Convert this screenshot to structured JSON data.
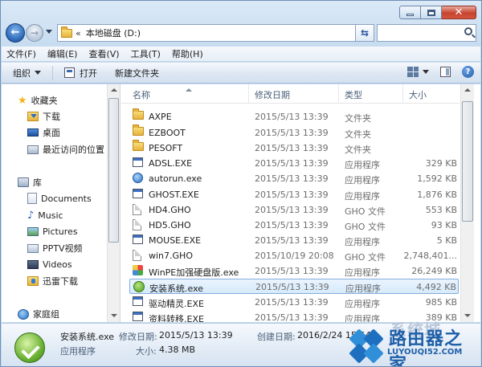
{
  "address": {
    "chevron": "«",
    "path": "本地磁盘 (D:)"
  },
  "menu": [
    "文件(F)",
    "编辑(E)",
    "查看(V)",
    "工具(T)",
    "帮助(H)"
  ],
  "toolbar": {
    "organize": "组织",
    "open": "打开",
    "new_folder": "新建文件夹"
  },
  "columns": {
    "name": "名称",
    "date": "修改日期",
    "type": "类型",
    "size": "大小"
  },
  "sidebar": [
    {
      "label": "收藏夹",
      "icon": "star-icon"
    },
    {
      "label": "下载",
      "icon": "download-folder-icon"
    },
    {
      "label": "桌面",
      "icon": "desktop-icon"
    },
    {
      "label": "最近访问的位置",
      "icon": "recent-places-icon"
    },
    {
      "label": "库",
      "icon": "library-icon"
    },
    {
      "label": "Documents",
      "icon": "documents-icon"
    },
    {
      "label": "Music",
      "icon": "music-icon"
    },
    {
      "label": "Pictures",
      "icon": "pictures-icon"
    },
    {
      "label": "PPTV视频",
      "icon": "pptv-icon"
    },
    {
      "label": "Videos",
      "icon": "videos-icon"
    },
    {
      "label": "迅雷下载",
      "icon": "xunlei-folder-icon"
    },
    {
      "label": "家庭组",
      "icon": "homegroup-icon"
    }
  ],
  "files": [
    {
      "name": "AXPE",
      "date": "2015/5/13 13:39",
      "type": "文件夹",
      "size": "",
      "icon": "folder-icon"
    },
    {
      "name": "EZBOOT",
      "date": "2015/5/13 13:39",
      "type": "文件夹",
      "size": "",
      "icon": "folder-icon"
    },
    {
      "name": "PESOFT",
      "date": "2015/5/13 13:39",
      "type": "文件夹",
      "size": "",
      "icon": "folder-icon"
    },
    {
      "name": "ADSL.EXE",
      "date": "2015/5/13 13:39",
      "type": "应用程序",
      "size": "329 KB",
      "icon": "exe-icon"
    },
    {
      "name": "autorun.exe",
      "date": "2015/5/13 13:39",
      "type": "应用程序",
      "size": "1,592 KB",
      "icon": "globe-icon"
    },
    {
      "name": "GHOST.EXE",
      "date": "2015/5/13 13:39",
      "type": "应用程序",
      "size": "1,876 KB",
      "icon": "exe-icon"
    },
    {
      "name": "HD4.GHO",
      "date": "2015/5/13 13:39",
      "type": "GHO 文件",
      "size": "553 KB",
      "icon": "file-icon"
    },
    {
      "name": "HD5.GHO",
      "date": "2015/5/13 13:39",
      "type": "GHO 文件",
      "size": "93 KB",
      "icon": "file-icon"
    },
    {
      "name": "MOUSE.EXE",
      "date": "2015/5/13 13:39",
      "type": "应用程序",
      "size": "5 KB",
      "icon": "exe-icon"
    },
    {
      "name": "win7.GHO",
      "date": "2015/10/19 20:08",
      "type": "GHO 文件",
      "size": "2,748,401...",
      "icon": "file-icon"
    },
    {
      "name": "WinPE加强硬盘版.exe",
      "date": "2015/5/13 13:39",
      "type": "应用程序",
      "size": "26,249 KB",
      "icon": "multicolor-app-icon"
    },
    {
      "name": "安装系统.exe",
      "date": "2015/5/13 13:39",
      "type": "应用程序",
      "size": "4,492 KB",
      "icon": "green-install-icon",
      "selected": true
    },
    {
      "name": "驱动精灵.EXE",
      "date": "2015/5/13 13:39",
      "type": "应用程序",
      "size": "985 KB",
      "icon": "exe-icon"
    },
    {
      "name": "资料转移.EXE",
      "date": "2015/5/13 13:39",
      "type": "应用程序",
      "size": "389 KB",
      "icon": "exe-icon"
    }
  ],
  "details": {
    "name": "安装系统.exe",
    "type": "应用程序",
    "modified_label": "修改日期:",
    "modified_value": "2015/5/13 13:39",
    "size_label": "大小:",
    "size_value": "4.38 MB",
    "created_label": "创建日期:",
    "created_value": "2016/2/24 15:54"
  },
  "watermark": {
    "text": "路由器之家",
    "faint_text": "系统城",
    "url": "LUYOUQI52.COM"
  }
}
